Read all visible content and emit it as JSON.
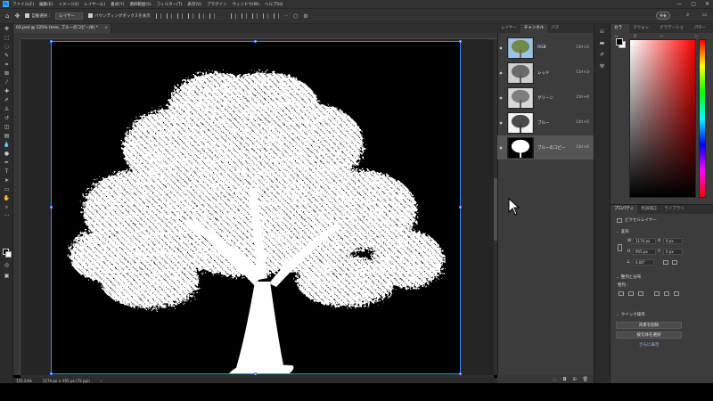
{
  "menu": {
    "app_icon": "Ps",
    "items": [
      "ファイル(F)",
      "編集(E)",
      "イメージ(I)",
      "レイヤー(L)",
      "書式(Y)",
      "選択範囲(S)",
      "フィルター(T)",
      "表示(V)",
      "プラグイン",
      "ウィンドウ(W)",
      "ヘルプ(H)"
    ],
    "window_controls": [
      "—",
      "▢",
      "✕"
    ]
  },
  "options": {
    "auto_select_label": "自動選択 :",
    "auto_select_value": "レイヤー",
    "bounding_label": "バウンディングボックスを表示",
    "share_label": "共有"
  },
  "document": {
    "tab_title": "02.psd @ 125% (tree, ブルーのコピー/8) *",
    "tab_close": "×",
    "zoom": "125.24%",
    "size_info": "1174 px × 955 px (72 ppi)"
  },
  "channels_panel": {
    "tabs": [
      "レイヤー",
      "チャンネル",
      "パス"
    ],
    "active_tab": 1,
    "rows": [
      {
        "name": "RGB",
        "shortcut": "Ctrl+2",
        "visible": true
      },
      {
        "name": "レッド",
        "shortcut": "Ctrl+3",
        "visible": true
      },
      {
        "name": "グリーン",
        "shortcut": "Ctrl+4",
        "visible": true
      },
      {
        "name": "ブルー",
        "shortcut": "Ctrl+5",
        "visible": true
      },
      {
        "name": "ブルーのコピー",
        "shortcut": "Ctrl+6",
        "visible": true,
        "selected": true
      }
    ],
    "footer_icons": [
      "dotted-circle-icon",
      "mask-icon",
      "new-channel-icon",
      "trash-icon"
    ]
  },
  "color_panel": {
    "tabs": [
      "カラー",
      "スウォッチ",
      "グラデーション",
      "パターン"
    ],
    "active_tab": 0,
    "foreground": "#000000",
    "background": "#ffffff",
    "hue": "#ff0000"
  },
  "properties_panel": {
    "tabs": [
      "プロパティ",
      "色調補正",
      "ライブラリ"
    ],
    "active_tab": 0,
    "layer_type": "ピクセルレイヤー",
    "transform_title": "変形",
    "w_label": "W",
    "w_value": "1174 px",
    "h_label": "H",
    "h_value": "955 px",
    "x_label": "X",
    "x_value": "0 px",
    "y_label": "Y",
    "y_value": "0 px",
    "angle_value": "0.00°",
    "align_title": "整列と分布",
    "align_sub": "整列 :",
    "quick_title": "クイック操作",
    "btn_remove_bg": "背景を削除",
    "btn_select_subject": "被写体を選択",
    "more": "さらに表示"
  }
}
